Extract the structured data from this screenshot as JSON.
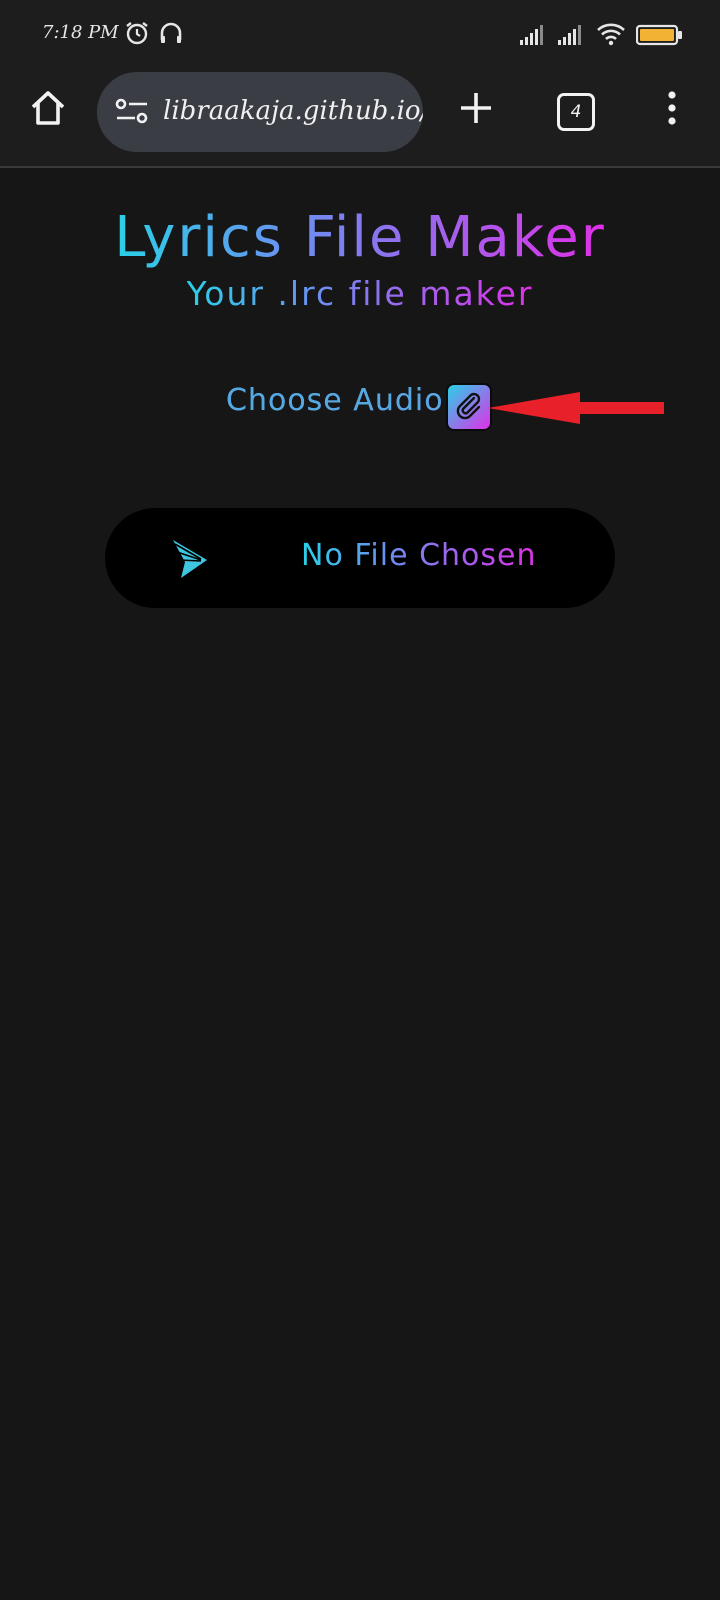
{
  "status_bar": {
    "time": "7:18 PM",
    "icons": [
      "alarm-icon",
      "headphones-icon",
      "signal-icon",
      "signal-icon",
      "wifi-icon",
      "battery-icon"
    ],
    "battery_color": "#f2b233"
  },
  "browser": {
    "url": "libraakaja.github.io/L",
    "tab_count": "4",
    "icons": [
      "home-icon",
      "site-settings-icon",
      "new-tab-icon",
      "tab-switcher-icon",
      "more-menu-icon"
    ]
  },
  "page": {
    "title": "Lyrics File Maker",
    "subtitle": "Your .lrc file maker",
    "choose_label": "Choose Audio",
    "file_status": "No File Chosen",
    "gradient": [
      "#2ad0e8",
      "#7a82f0",
      "#e030e8"
    ],
    "background": "#161616"
  },
  "annotation": {
    "arrow_color": "#e8202a"
  }
}
